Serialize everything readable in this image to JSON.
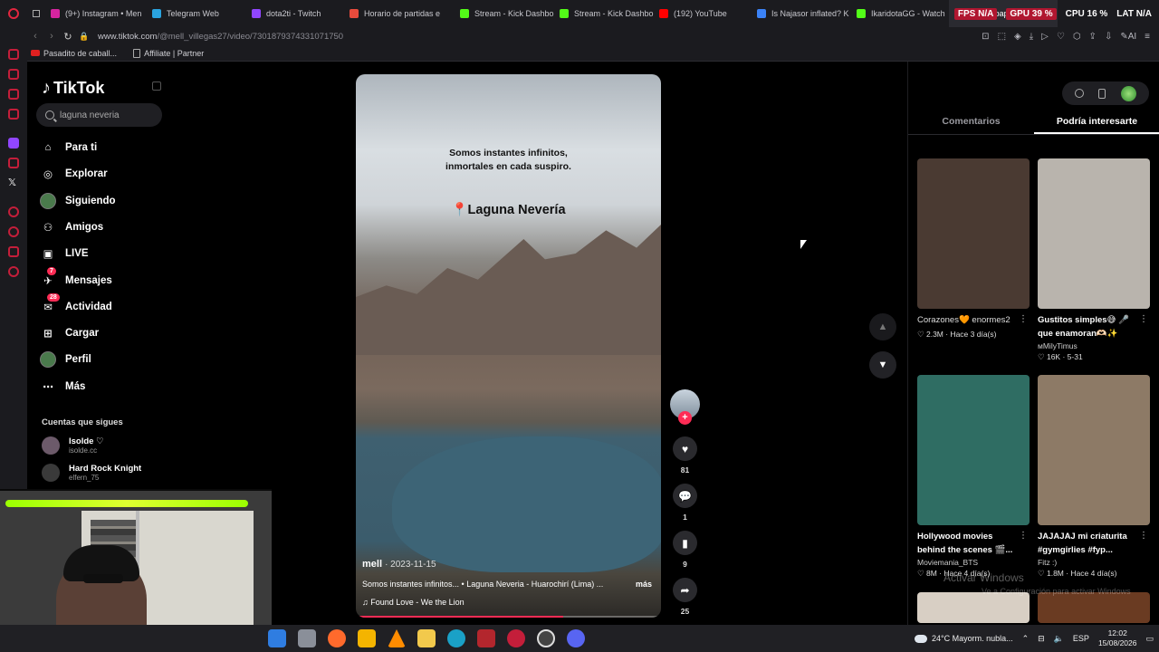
{
  "browser": {
    "tabs": [
      {
        "label": "(9+) Instagram • Men",
        "color": "#d6249f"
      },
      {
        "label": "Telegram Web",
        "color": "#2aa3df"
      },
      {
        "label": "dota2ti - Twitch",
        "color": "#9146ff"
      },
      {
        "label": "Horario de partidas e",
        "color": "#e94b3c"
      },
      {
        "label": "Stream - Kick Dashbo",
        "color": "#53fc18"
      },
      {
        "label": "Stream - Kick Dashbo",
        "color": "#53fc18"
      },
      {
        "label": "(192) YouTube",
        "color": "#ff0000"
      },
      {
        "label": "Is Najasor inflated? K",
        "color": "#3b82f6"
      },
      {
        "label": "IkaridotaGG - Watch",
        "color": "#53fc18"
      },
      {
        "label": "@mbs papers",
        "color": "#fe2c55"
      }
    ],
    "sys": {
      "fps": "FPS N/A",
      "gpu": "GPU 39 %",
      "cpu": "CPU 16 %",
      "lat": "LAT N/A"
    },
    "url_host": "www.tiktok.com",
    "url_path": "/@mell_villegas27/video/7301879374331071750",
    "bookmarks": [
      "Pasadito de caball...",
      "Affiliate | Partner"
    ]
  },
  "tiktok": {
    "logo": "TikTok",
    "search_value": "laguna neveria",
    "nav": [
      {
        "label": "Para ti",
        "icon": "home-icon"
      },
      {
        "label": "Explorar",
        "icon": "compass-icon"
      },
      {
        "label": "Siguiendo",
        "icon": "following-avatar-icon"
      },
      {
        "label": "Amigos",
        "icon": "friends-icon"
      },
      {
        "label": "LIVE",
        "icon": "live-icon"
      },
      {
        "label": "Mensajes",
        "icon": "messages-icon",
        "badge": "7"
      },
      {
        "label": "Actividad",
        "icon": "activity-icon",
        "badge": "28"
      },
      {
        "label": "Cargar",
        "icon": "upload-icon"
      },
      {
        "label": "Perfil",
        "icon": "profile-icon"
      },
      {
        "label": "Más",
        "icon": "more-icon"
      }
    ],
    "following_title": "Cuentas que sigues",
    "following": [
      {
        "name": "Isolde ♡",
        "handle": "isolde.cc"
      },
      {
        "name": "Hard Rock Knight",
        "handle": "elfern_75"
      }
    ],
    "video": {
      "quote": "Somos instantes infinitos,\ninmortales en cada suspiro.",
      "location": "Laguna Nevería",
      "author": "mell",
      "date": "· 2023-11-15",
      "description": "Somos instantes infinitos... • Laguna Neveria - Huarochirí (Lima) ...",
      "more": "más",
      "music": "♫  Found Love - We the Lion",
      "progress": 0.68
    },
    "actions": {
      "likes": "81",
      "comments": "1",
      "saves": "9",
      "shares": "25"
    },
    "right_tabs": {
      "comments": "Comentarios",
      "suggested": "Podría interesarte"
    },
    "suggested": [
      {
        "title": "Corazones🧡 enormes2",
        "author": "",
        "stats": "♡ 2.3M · Hace 3 día(s)",
        "bold": false,
        "thumb": "#4a3a32"
      },
      {
        "title": "Gustitos simples😅 🎤 que enamoran🫶🏻✨",
        "author": "ᴍMilyTimus",
        "stats": "♡ 16K · 5-31",
        "bold": true,
        "thumb": "#b9b4ad"
      },
      {
        "title": "Hollywood movies behind the scenes 🎬...",
        "author": "Moviemania_BTS",
        "stats": "♡ 8M · Hace 4 día(s)",
        "bold": true,
        "thumb": "#2f6d63"
      },
      {
        "title": "JAJAJAJ mi criaturita #gymgirlies #fyp...",
        "author": "Fitz :)",
        "stats": "♡ 1.8M · Hace 4 día(s)",
        "bold": true,
        "thumb": "#8d7a66"
      }
    ],
    "watermark": "Activar Windows",
    "watermark_sub": "Ve a Configuración para activar Windows"
  },
  "taskbar": {
    "weather": "24°C  Mayorm. nubla...",
    "lang": "ESP",
    "time": "12:02",
    "date": "15/08/2026"
  }
}
